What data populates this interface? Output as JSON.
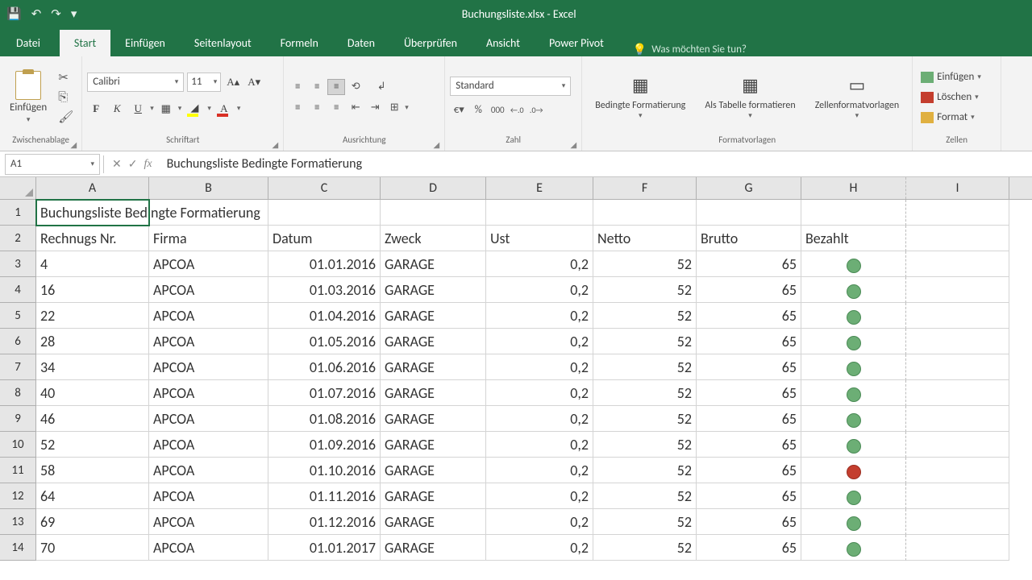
{
  "titlebar": {
    "title": "Buchungsliste.xlsx - Excel"
  },
  "qat": {
    "save": "💾",
    "undo": "↶",
    "redo": "↷",
    "more": "▾"
  },
  "tabs": {
    "file": "Datei",
    "home": "Start",
    "insert": "Einfügen",
    "layout": "Seitenlayout",
    "formulas": "Formeln",
    "data": "Daten",
    "review": "Überprüfen",
    "view": "Ansicht",
    "powerpivot": "Power Pivot"
  },
  "tellme": {
    "placeholder": "Was möchten Sie tun?"
  },
  "ribbon": {
    "clipboard": {
      "paste": "Einfügen",
      "label": "Zwischenablage"
    },
    "font": {
      "name": "Calibri",
      "size": "11",
      "bold": "F",
      "italic": "K",
      "underline": "U",
      "label": "Schriftart"
    },
    "alignment": {
      "label": "Ausrichtung"
    },
    "number": {
      "format": "Standard",
      "label": "Zahl"
    },
    "styles": {
      "cond": "Bedingte Formatierung",
      "table": "Als Tabelle formatieren",
      "cell": "Zellenformatvorlagen",
      "label": "Formatvorlagen"
    },
    "cells": {
      "insert": "Einfügen",
      "delete": "Löschen",
      "format": "Format",
      "label": "Zellen"
    }
  },
  "namebox": "A1",
  "formula": "Buchungsliste Bedingte Formatierung",
  "columns": [
    "A",
    "B",
    "C",
    "D",
    "E",
    "F",
    "G",
    "H",
    "I"
  ],
  "headers": {
    "title": "Buchungsliste Bedingte Formatierung",
    "A": "Rechnugs Nr.",
    "B": "Firma",
    "C": "Datum",
    "D": "Zweck",
    "E": "Ust",
    "F": "Netto",
    "G": "Brutto",
    "H": "Bezahlt"
  },
  "rows": [
    {
      "nr": "4",
      "firma": "APCOA",
      "datum": "01.01.2016",
      "zweck": "GARAGE",
      "ust": "0,2",
      "netto": "52",
      "brutto": "65",
      "paid": "green"
    },
    {
      "nr": "16",
      "firma": "APCOA",
      "datum": "01.03.2016",
      "zweck": "GARAGE",
      "ust": "0,2",
      "netto": "52",
      "brutto": "65",
      "paid": "green"
    },
    {
      "nr": "22",
      "firma": "APCOA",
      "datum": "01.04.2016",
      "zweck": "GARAGE",
      "ust": "0,2",
      "netto": "52",
      "brutto": "65",
      "paid": "green"
    },
    {
      "nr": "28",
      "firma": "APCOA",
      "datum": "01.05.2016",
      "zweck": "GARAGE",
      "ust": "0,2",
      "netto": "52",
      "brutto": "65",
      "paid": "green"
    },
    {
      "nr": "34",
      "firma": "APCOA",
      "datum": "01.06.2016",
      "zweck": "GARAGE",
      "ust": "0,2",
      "netto": "52",
      "brutto": "65",
      "paid": "green"
    },
    {
      "nr": "40",
      "firma": "APCOA",
      "datum": "01.07.2016",
      "zweck": "GARAGE",
      "ust": "0,2",
      "netto": "52",
      "brutto": "65",
      "paid": "green"
    },
    {
      "nr": "46",
      "firma": "APCOA",
      "datum": "01.08.2016",
      "zweck": "GARAGE",
      "ust": "0,2",
      "netto": "52",
      "brutto": "65",
      "paid": "green"
    },
    {
      "nr": "52",
      "firma": "APCOA",
      "datum": "01.09.2016",
      "zweck": "GARAGE",
      "ust": "0,2",
      "netto": "52",
      "brutto": "65",
      "paid": "green"
    },
    {
      "nr": "58",
      "firma": "APCOA",
      "datum": "01.10.2016",
      "zweck": "GARAGE",
      "ust": "0,2",
      "netto": "52",
      "brutto": "65",
      "paid": "red"
    },
    {
      "nr": "64",
      "firma": "APCOA",
      "datum": "01.11.2016",
      "zweck": "GARAGE",
      "ust": "0,2",
      "netto": "52",
      "brutto": "65",
      "paid": "green"
    },
    {
      "nr": "69",
      "firma": "APCOA",
      "datum": "01.12.2016",
      "zweck": "GARAGE",
      "ust": "0,2",
      "netto": "52",
      "brutto": "65",
      "paid": "green"
    },
    {
      "nr": "70",
      "firma": "APCOA",
      "datum": "01.01.2017",
      "zweck": "GARAGE",
      "ust": "0,2",
      "netto": "52",
      "brutto": "65",
      "paid": "green"
    }
  ]
}
